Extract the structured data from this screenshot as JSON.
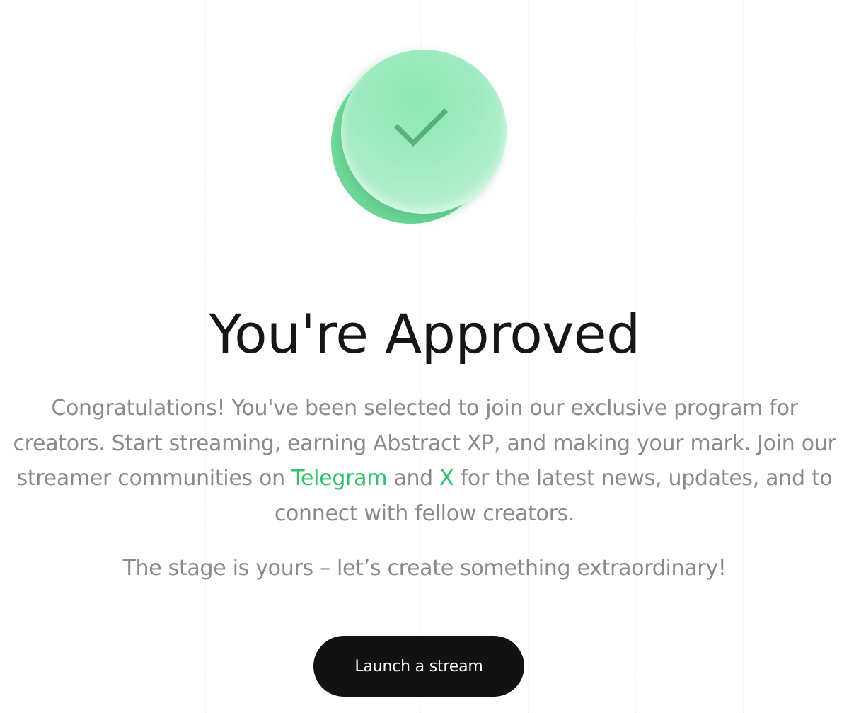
{
  "badge": {
    "icon": "check-icon",
    "colors": {
      "disc_light": "#b9f1d1",
      "disc_dark": "#6fd89a",
      "check": "#4aa875"
    }
  },
  "title": "You're Approved",
  "message": {
    "part1": "Congratulations! You've been selected to join our exclusive program for creators. Start streaming, earning Abstract XP, and making your mark. Join our streamer communities on ",
    "telegram_link": "Telegram",
    "part2": " and ",
    "x_link": "X",
    "part3": " for the latest news, updates, and to connect with fellow creators."
  },
  "tagline": "The stage is yours – let’s create something extraordinary!",
  "cta": {
    "label": "Launch a stream"
  },
  "colors": {
    "accent": "#33c16d",
    "text_muted": "#8a8a8a",
    "title": "#161616",
    "button_bg": "#121212",
    "button_text": "#ffffff"
  }
}
